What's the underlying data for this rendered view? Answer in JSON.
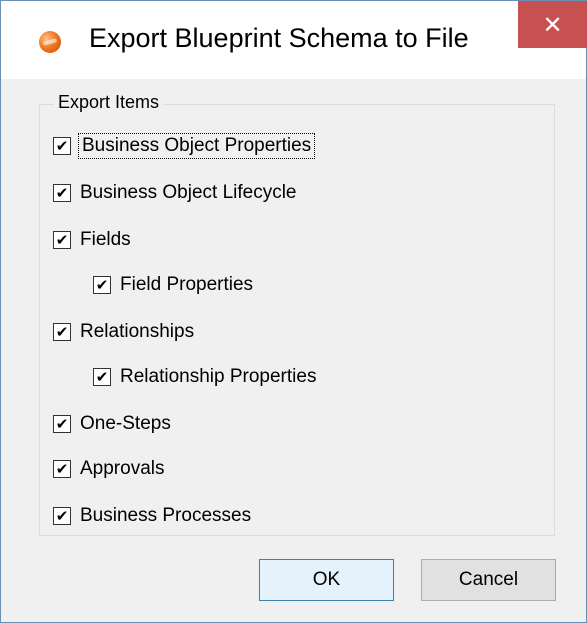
{
  "window": {
    "title": "Export Blueprint Schema to File",
    "close_glyph": "✕"
  },
  "group": {
    "legend": "Export Items",
    "items": [
      {
        "label": "Business Object Properties",
        "checked": true,
        "indent": 0,
        "focused": true
      },
      {
        "label": "Business Object Lifecycle",
        "checked": true,
        "indent": 0
      },
      {
        "label": "Fields",
        "checked": true,
        "indent": 0
      },
      {
        "label": "Field Properties",
        "checked": true,
        "indent": 1
      },
      {
        "label": "Relationships",
        "checked": true,
        "indent": 0
      },
      {
        "label": "Relationship Properties",
        "checked": true,
        "indent": 1
      },
      {
        "label": "One-Steps",
        "checked": true,
        "indent": 0
      },
      {
        "label": "Approvals",
        "checked": true,
        "indent": 0
      },
      {
        "label": "Business Processes",
        "checked": true,
        "indent": 0
      }
    ]
  },
  "buttons": {
    "ok_label": "OK",
    "cancel_label": "Cancel"
  },
  "colors": {
    "close_button": "#c75050",
    "dialog_background": "#f0f0f0",
    "default_button_border": "#3c7fb1"
  },
  "icons": {
    "app": "orange-sphere-icon",
    "close": "close-icon",
    "check": "checkmark-icon"
  }
}
